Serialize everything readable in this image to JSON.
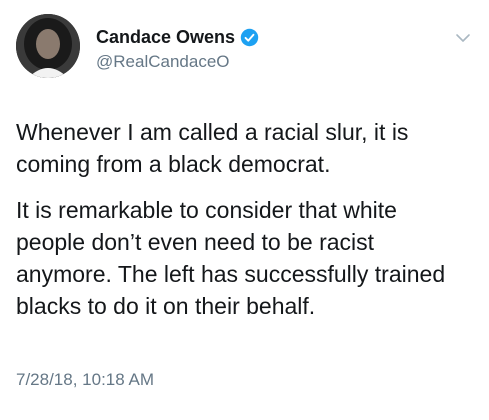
{
  "tweet": {
    "display_name": "Candace Owens",
    "handle": "@RealCandaceO",
    "paragraphs": [
      "Whenever I am called a racial slur, it is coming from a black democrat.",
      "It is remarkable to consider that white people don’t even need to be racist anymore. The left has successfully trained blacks to do it on their behalf."
    ],
    "timestamp": "7/28/18, 10:18 AM",
    "icons": {
      "verified": "verified-badge-icon",
      "menu": "chevron-down-icon",
      "avatar": "profile-photo"
    },
    "colors": {
      "verified_blue": "#1da1f2",
      "secondary_text": "#657786",
      "primary_text": "#14171a"
    }
  }
}
